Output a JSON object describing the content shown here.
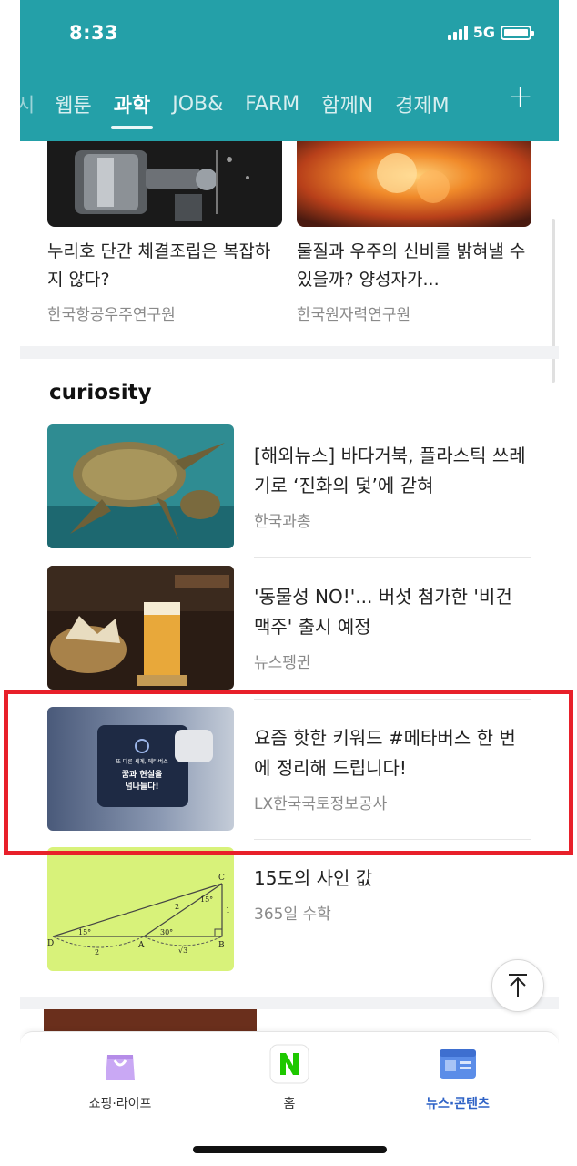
{
  "status_bar": {
    "time": "8:33",
    "network": "5G"
  },
  "tabs": [
    {
      "label": "시",
      "partial": true
    },
    {
      "label": "웹툰"
    },
    {
      "label": "과학",
      "active": true
    },
    {
      "label": "JOB&"
    },
    {
      "label": "FARM"
    },
    {
      "label": "함께N"
    },
    {
      "label": "경제M"
    }
  ],
  "tabs_add": "+",
  "top_cards": [
    {
      "title": "누리호 단간 체결조립은 복잡하지 않다?",
      "source": "한국항공우주연구원"
    },
    {
      "title": "물질과 우주의 신비를 밝혀낼 수 있을까? 양성자가...",
      "source": "한국원자력연구원"
    }
  ],
  "section": {
    "title": "curiosity"
  },
  "items": [
    {
      "title": "[해외뉴스] 바다거북, 플라스틱 쓰레기로 ‘진화의 덫’에 갇혀",
      "source": "한국과총"
    },
    {
      "title": "'동물성 NO!'... 버섯 첨가한 '비건 맥주' 출시 예정",
      "source": "뉴스펭귄"
    },
    {
      "title": "요즘 핫한 키워드 #메타버스 한 번에 정리해 드립니다!",
      "source": "LX한국국토정보공사",
      "thumb_text": {
        "top": "또 다른 세계, 메타버스",
        "main1": "꿈과 현실을",
        "main2": "넘나들다!"
      }
    },
    {
      "title": "15도의 사인 값",
      "source": "365일 수학",
      "diagram_labels": {
        "A": "A",
        "B": "B",
        "C": "C",
        "D": "D",
        "angle1": "15°",
        "angle2": "30°",
        "angle3": "15°",
        "len_dc": "2",
        "len_ab": "√3",
        "len_ac": "2",
        "len_bc": "1"
      }
    }
  ],
  "bottom_nav": [
    {
      "label": "쇼핑·라이프",
      "icon": "shopping-bag-icon"
    },
    {
      "label": "홈",
      "icon": "naver-n-icon"
    },
    {
      "label": "뉴스·콘텐츠",
      "icon": "news-icon",
      "active": true
    }
  ],
  "colors": {
    "header": "#24a0a8",
    "highlight": "#e8202a",
    "active_nav": "#2e62c6"
  }
}
